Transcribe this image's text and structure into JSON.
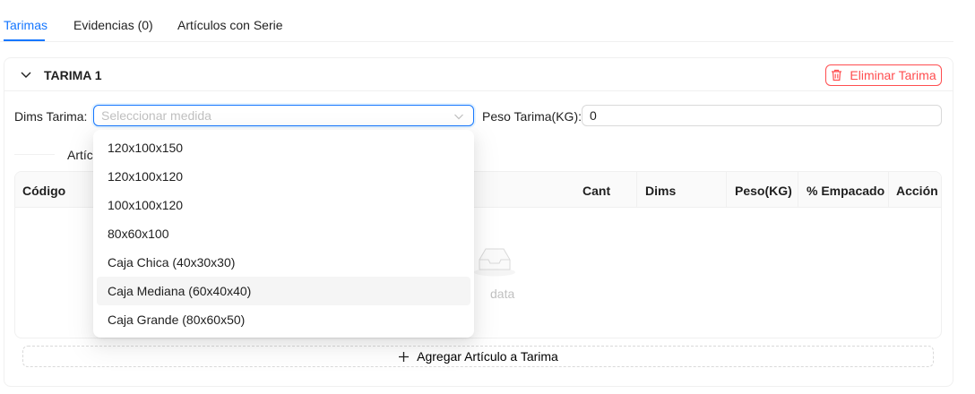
{
  "tabs": [
    {
      "label": "Tarimas",
      "active": true
    },
    {
      "label": "Evidencias (0)",
      "active": false
    },
    {
      "label": "Artículos con Serie",
      "active": false
    }
  ],
  "card": {
    "title": "TARIMA 1",
    "delete_label": "Eliminar Tarima"
  },
  "form": {
    "dims_label": "Dims Tarima",
    "dims_placeholder": "Seleccionar medida",
    "weight_label": "Peso Tarima(KG)",
    "weight_value": "0"
  },
  "section_label": "Artíc",
  "table": {
    "columns": [
      "Código",
      "Cant",
      "Dims",
      "Peso(KG)",
      "% Empacado",
      "Acción"
    ],
    "empty_text": "data"
  },
  "add_label": "Agregar Artículo a Tarima",
  "dropdown": {
    "options": [
      "120x100x150",
      "120x100x120",
      "100x100x120",
      "80x60x100",
      "Caja Chica (40x30x30)",
      "Caja Mediana (60x40x40)",
      "Caja Grande (80x60x50)"
    ],
    "active_index": 5
  },
  "colors": {
    "primary": "#1677ff",
    "danger": "#ff4d4f"
  }
}
